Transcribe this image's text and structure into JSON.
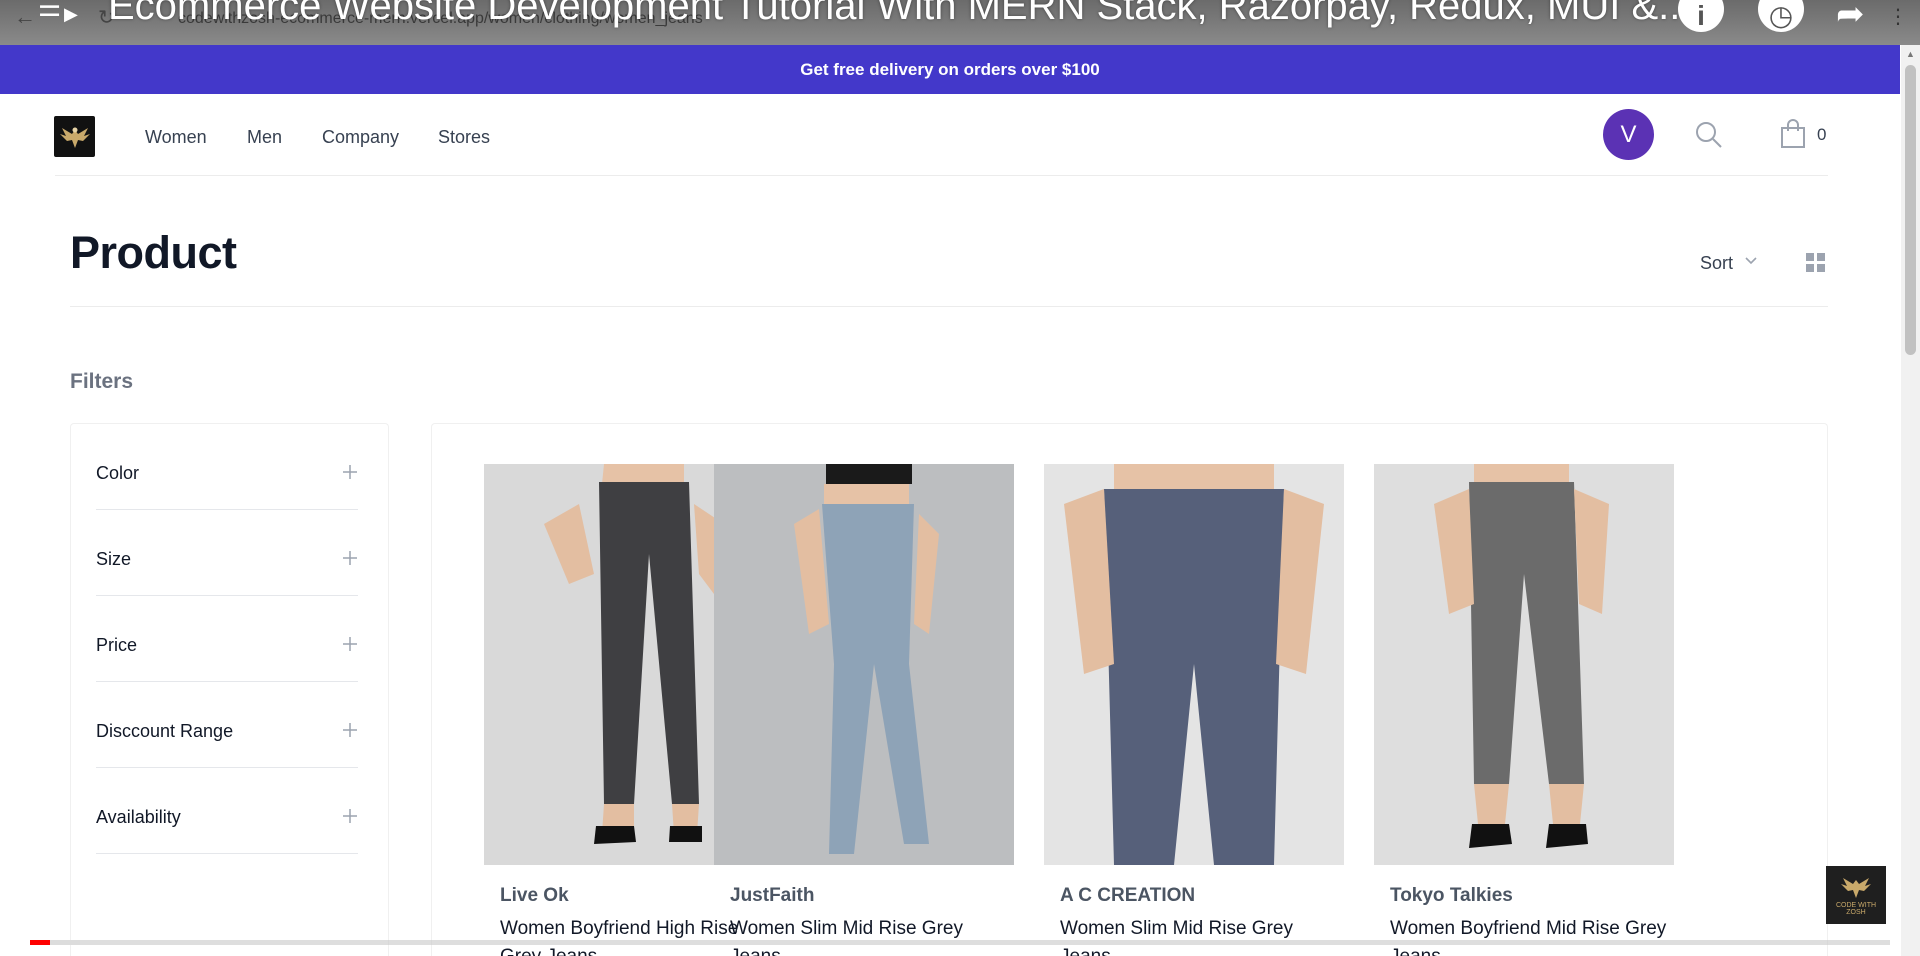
{
  "video": {
    "title": "Ecommerce Website Development Tutorial With MERN Stack, Razorpay, Redux, MUI &...",
    "url": "codewithzosh-ecommerce-mern.vercel.app/women/clothing/women_jeans",
    "watermark": "CODE WITH ZOSH",
    "progress_percent": 1
  },
  "banner": {
    "text": "Get free delivery on orders over $100"
  },
  "nav": {
    "links": [
      "Women",
      "Men",
      "Company",
      "Stores"
    ],
    "avatar_letter": "V",
    "cart_count": "0",
    "accent": "#4338ca"
  },
  "page": {
    "title": "Product",
    "sort_label": "Sort",
    "filters_label": "Filters"
  },
  "filters": [
    "Color",
    "Size",
    "Price",
    "Disccount Range",
    "Availability"
  ],
  "products": [
    {
      "brand": "Live Ok",
      "name": "Women Boyfriend High Rise Grey Jeans"
    },
    {
      "brand": "JustFaith",
      "name": "Women Slim Mid Rise Grey Jeans"
    },
    {
      "brand": "A C CREATION",
      "name": "Women Slim Mid Rise Grey Jeans"
    },
    {
      "brand": "Tokyo Talkies",
      "name": "Women Boyfriend Mid Rise Grey Jeans"
    }
  ]
}
